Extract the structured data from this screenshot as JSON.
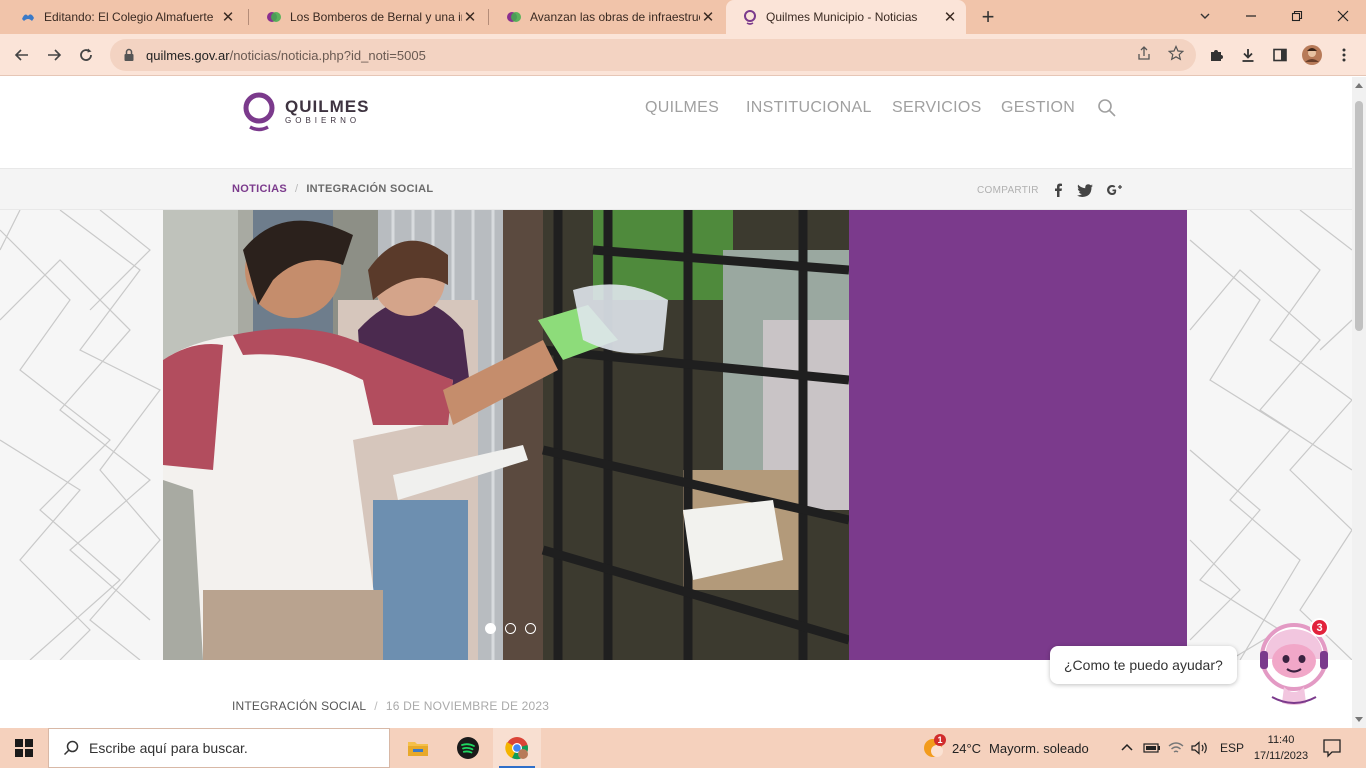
{
  "browser": {
    "tabs": [
      {
        "title": "Editando: El Colegio Almafuerte",
        "active": false
      },
      {
        "title": "Los Bomberos de Bernal y una ir",
        "active": false
      },
      {
        "title": "Avanzan las obras de infraestruc",
        "active": false
      },
      {
        "title": "Quilmes Municipio - Noticias",
        "active": true
      }
    ],
    "url_host": "quilmes.gov.ar",
    "url_path": "/noticias/noticia.php?id_noti=5005"
  },
  "site": {
    "logo_name": "QUILMES",
    "logo_sub": "GOBIERNO",
    "nav": [
      "QUILMES",
      "INSTITUCIONAL",
      "SERVICIOS",
      "GESTION"
    ],
    "breadcrumb": {
      "root": "NOTICIAS",
      "separator": "/",
      "current": "INTEGRACIÓN SOCIAL"
    },
    "share_label": "COMPARTIR",
    "accent_color": "#7b3a8c"
  },
  "article": {
    "category": "INTEGRACIÓN SOCIAL",
    "separator": "/",
    "date": "16 DE NOVIEMBRE DE 2023",
    "slider_current_index": 1,
    "slider_count": 3
  },
  "chat": {
    "prompt": "¿Como te puedo ayudar?",
    "badge": "3"
  },
  "taskbar": {
    "search_placeholder": "Escribe aquí para buscar.",
    "weather_temp": "24°C",
    "weather_text": "Mayorm. soleado",
    "weather_badge": "1",
    "language": "ESP",
    "time": "11:40",
    "date": "17/11/2023"
  }
}
